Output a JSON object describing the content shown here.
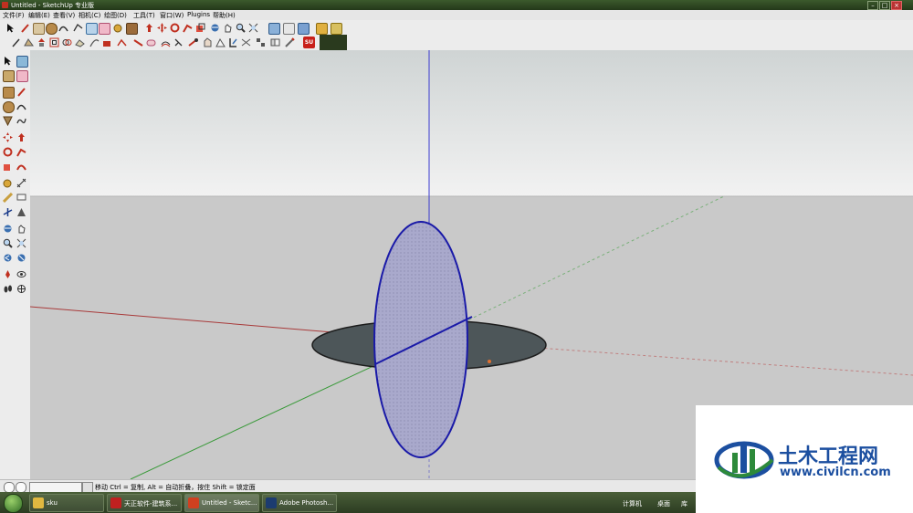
{
  "window": {
    "title": "Untitled - SketchUp 专业版"
  },
  "menu": [
    "文件(F)",
    "编辑(E)",
    "查看(V)",
    "相机(C)",
    "绘图(D)",
    "工具(T)",
    "窗口(W)",
    "Plugins",
    "帮助(H)"
  ],
  "status": {
    "hint": "移动 Ctrl = 复制, Alt = 自动折叠，按住 Shift = 锁定面"
  },
  "taskbar": {
    "items": [
      "sku",
      "天正软件-建筑系...",
      "Untitled - Sketc...",
      "Adobe Photosh..."
    ],
    "tray": [
      "计算机",
      "桌面",
      "库"
    ]
  },
  "watermark": {
    "name": "土木工程网",
    "url": "www.civilcn.com"
  },
  "colors": {
    "sky": "#d8dcdc",
    "ground": "#c9c9c9",
    "vertical_face": "#a9a9cc",
    "horizontal_face": "#4d5659",
    "watermark_blue": "#1c4fa0"
  }
}
